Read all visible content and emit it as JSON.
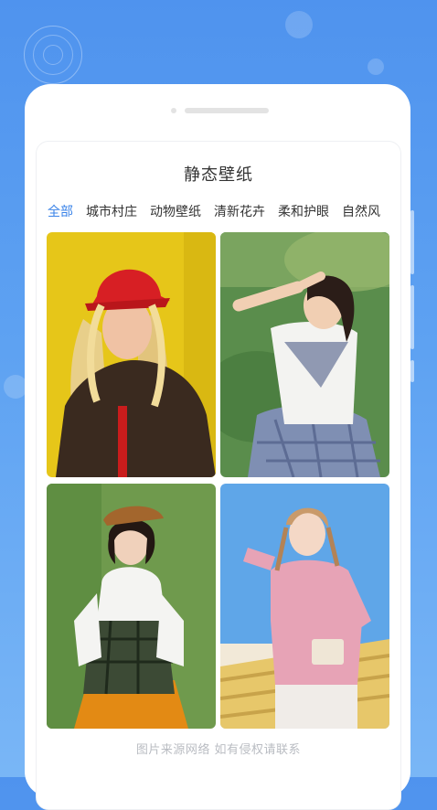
{
  "header": {
    "title": "静态壁纸"
  },
  "tabs": [
    {
      "label": "全部",
      "active": true
    },
    {
      "label": "城市村庄",
      "active": false
    },
    {
      "label": "动物壁纸",
      "active": false
    },
    {
      "label": "清新花卉",
      "active": false
    },
    {
      "label": "柔和护眼",
      "active": false
    },
    {
      "label": "自然风",
      "active": false
    }
  ],
  "wallpapers": [
    {
      "desc": "woman with curly blonde hair in red cap, yellow background"
    },
    {
      "desc": "girl in sailor uniform shielding eyes on grass"
    },
    {
      "desc": "woman with bob haircut and beret, green background"
    },
    {
      "desc": "girl in pink sweater against blue sky"
    }
  ],
  "footer": {
    "note": "图片来源网络 如有侵权请联系"
  },
  "colors": {
    "accent": "#3a83e8",
    "background": "#5a9df0"
  }
}
